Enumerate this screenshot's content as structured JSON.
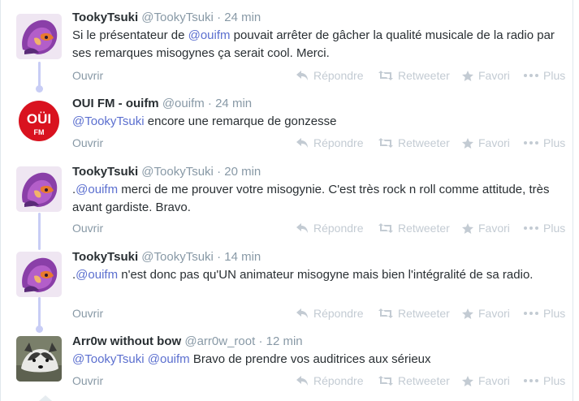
{
  "tweets": [
    {
      "fullname": "TookyTsuki",
      "username": "@TookyTsuki",
      "separator": "·",
      "time": "24 min",
      "text_parts": [
        "Si le présentateur de ",
        "@ouifm",
        " pouvait arrêter de gâcher la qualité musicale de la radio par ses remarques misogynes ça serait cool. Merci."
      ],
      "avatar": "purple-fox-avatar"
    },
    {
      "fullname": "OUI FM - ouifm",
      "username": "@ouifm",
      "separator": "·",
      "time": "24 min",
      "text_parts": [
        "@TookyTsuki",
        " encore une remarque de gonzesse"
      ],
      "avatar": "ouifm-logo-avatar",
      "logo_text": "OÜI",
      "logo_sub": "FM"
    },
    {
      "fullname": "TookyTsuki",
      "username": "@TookyTsuki",
      "separator": "·",
      "time": "20 min",
      "text_parts": [
        ".",
        "@ouifm",
        " merci de me prouver votre misogynie. C'est très rock n roll comme attitude, très avant gardiste. Bravo."
      ],
      "avatar": "purple-fox-avatar"
    },
    {
      "fullname": "TookyTsuki",
      "username": "@TookyTsuki",
      "separator": "·",
      "time": "14 min",
      "text_parts": [
        ".",
        "@ouifm",
        " n'est donc pas qu'UN animateur misogyne mais bien l'intégralité de sa radio."
      ],
      "avatar": "purple-fox-avatar"
    },
    {
      "fullname": "Arr0w without bow",
      "username": "@arr0w_root",
      "separator": "·",
      "time": "12 min",
      "text_parts": [
        "@TookyTsuki",
        " ",
        "@ouifm",
        " Bravo de prendre vos auditrices aux sérieux"
      ],
      "avatar": "husky-dog-avatar"
    }
  ],
  "actions": {
    "expand": "Ouvrir",
    "reply": "Répondre",
    "retweet": "Retweeter",
    "favorite": "Favori",
    "more": "Plus"
  },
  "colors": {
    "link": "#5b6fcf",
    "muted": "#8899a6",
    "action": "#c3cbd3",
    "thread": "#c8cdf5",
    "ouifm_red": "#d9121f"
  }
}
